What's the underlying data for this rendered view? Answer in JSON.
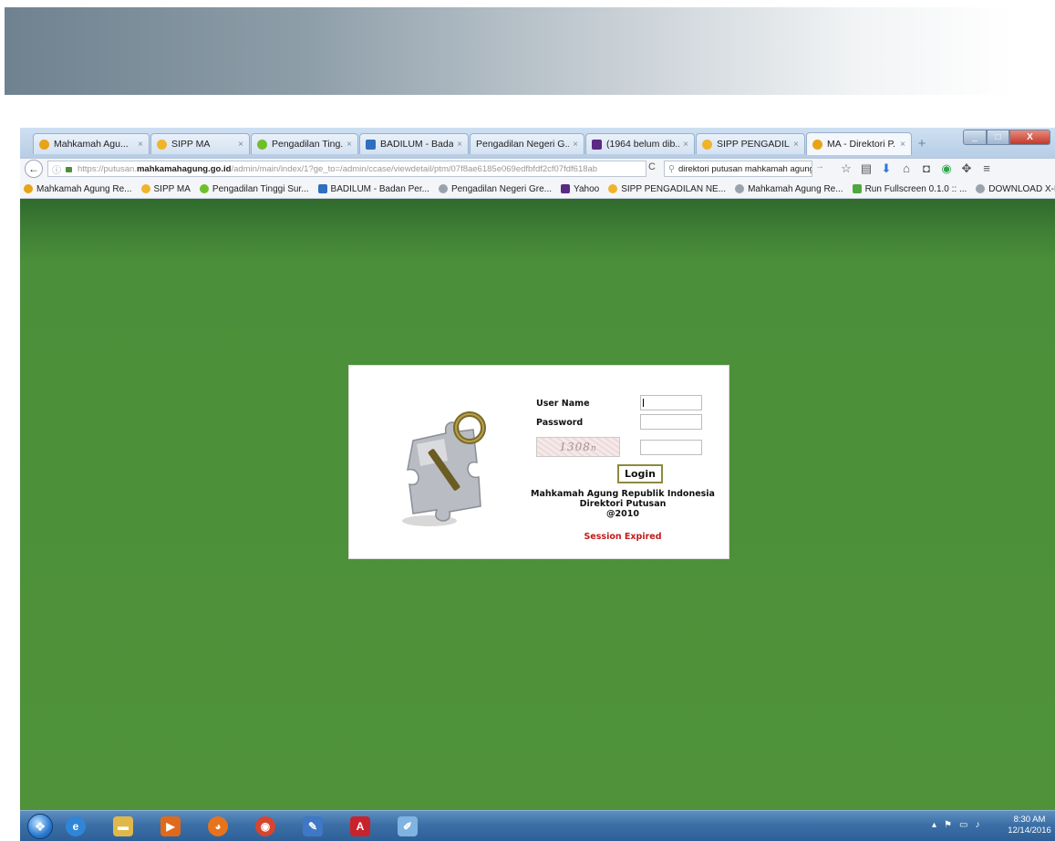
{
  "tabs": [
    {
      "title": "Mahkamah Agu...",
      "close": "×",
      "icon_color": "#e8a317"
    },
    {
      "title": "SIPP MA",
      "close": "×",
      "icon_color": "#f0b429"
    },
    {
      "title": "Pengadilan Ting...",
      "close": "×",
      "icon_color": "#6fbf2a"
    },
    {
      "title": "BADILUM - Bada...",
      "close": "×",
      "icon_color": "#2e6fc0"
    },
    {
      "title": "Pengadilan Negeri G...",
      "close": "×",
      "icon_color": "#d9d9d9"
    },
    {
      "title": "(1964 belum dib...",
      "close": "×",
      "icon_color": "#5b2a86"
    },
    {
      "title": "SIPP PENGADIL...",
      "close": "×",
      "icon_color": "#f0b429"
    },
    {
      "title": "MA - Direktori P...",
      "close": "×",
      "icon_color": "#e8a317"
    }
  ],
  "new_tab": "+",
  "window_controls": {
    "minimize": "_",
    "maximize": "□",
    "close": "X"
  },
  "navbar": {
    "back": "←",
    "url_prefix": "https://putusan.",
    "url_domain": "mahkamahagung.go.id",
    "url_path": "/admin/main/index/1?ge_to=/admin/ccase/viewdetail/ptm/07f8ae6185e069edfbfdf2cf07fdf618ab",
    "reload": "C",
    "search_value": "direktori putusan mahkamah agung",
    "search_go": "→",
    "toolbar_icons": [
      "☆",
      "▤",
      "⬇",
      "⌂",
      "◘",
      "◉",
      "✥",
      "≡"
    ]
  },
  "bookmarks": [
    {
      "label": "Mahkamah Agung Re...",
      "icon_color": "#e8a317"
    },
    {
      "label": "SIPP MA",
      "icon_color": "#f0b429"
    },
    {
      "label": "Pengadilan Tinggi Sur...",
      "icon_color": "#6fbf2a"
    },
    {
      "label": "BADILUM - Badan Per...",
      "icon_color": "#2e6fc0"
    },
    {
      "label": "Pengadilan Negeri Gre...",
      "icon_color": "#9aa3ad"
    },
    {
      "label": "Yahoo",
      "icon_color": "#5b2a86"
    },
    {
      "label": "SIPP PENGADILAN NE...",
      "icon_color": "#f0b429"
    },
    {
      "label": "Mahkamah Agung Re...",
      "icon_color": "#9aa3ad"
    },
    {
      "label": "Run Fullscreen 0.1.0 :: ...",
      "icon_color": "#4fa83d"
    },
    {
      "label": "DOWNLOAD X-KARA...",
      "icon_color": "#9aa3ad"
    }
  ],
  "login": {
    "username_label": "User Name",
    "password_label": "Password",
    "captcha_text": "1308",
    "captcha_suffix": "n",
    "button": "Login",
    "info_line1": "Mahkamah Agung Republik Indonesia",
    "info_line2": "Direktori Putusan",
    "info_line3": "@2010",
    "session_status": "Session Expired"
  },
  "taskbar": {
    "start": "❖",
    "apps": [
      {
        "name": "ie",
        "glyph": "e",
        "color": "#2f86d9"
      },
      {
        "name": "explorer",
        "glyph": "▬",
        "color": "#e0b84a"
      },
      {
        "name": "media",
        "glyph": "▶",
        "color": "#e06a1b"
      },
      {
        "name": "firefox",
        "glyph": "◕",
        "color": "#e8731c"
      },
      {
        "name": "chrome",
        "glyph": "◉",
        "color": "#d6452f"
      },
      {
        "name": "notepad",
        "glyph": "✎",
        "color": "#3f78c4"
      },
      {
        "name": "acrobat",
        "glyph": "A",
        "color": "#c8232c"
      },
      {
        "name": "paint",
        "glyph": "✐",
        "color": "#7fb3e0"
      }
    ],
    "tray_icons": [
      "▴",
      "⚑",
      "▭",
      "♪"
    ],
    "time": "8:30 AM",
    "date": "12/14/2016"
  }
}
